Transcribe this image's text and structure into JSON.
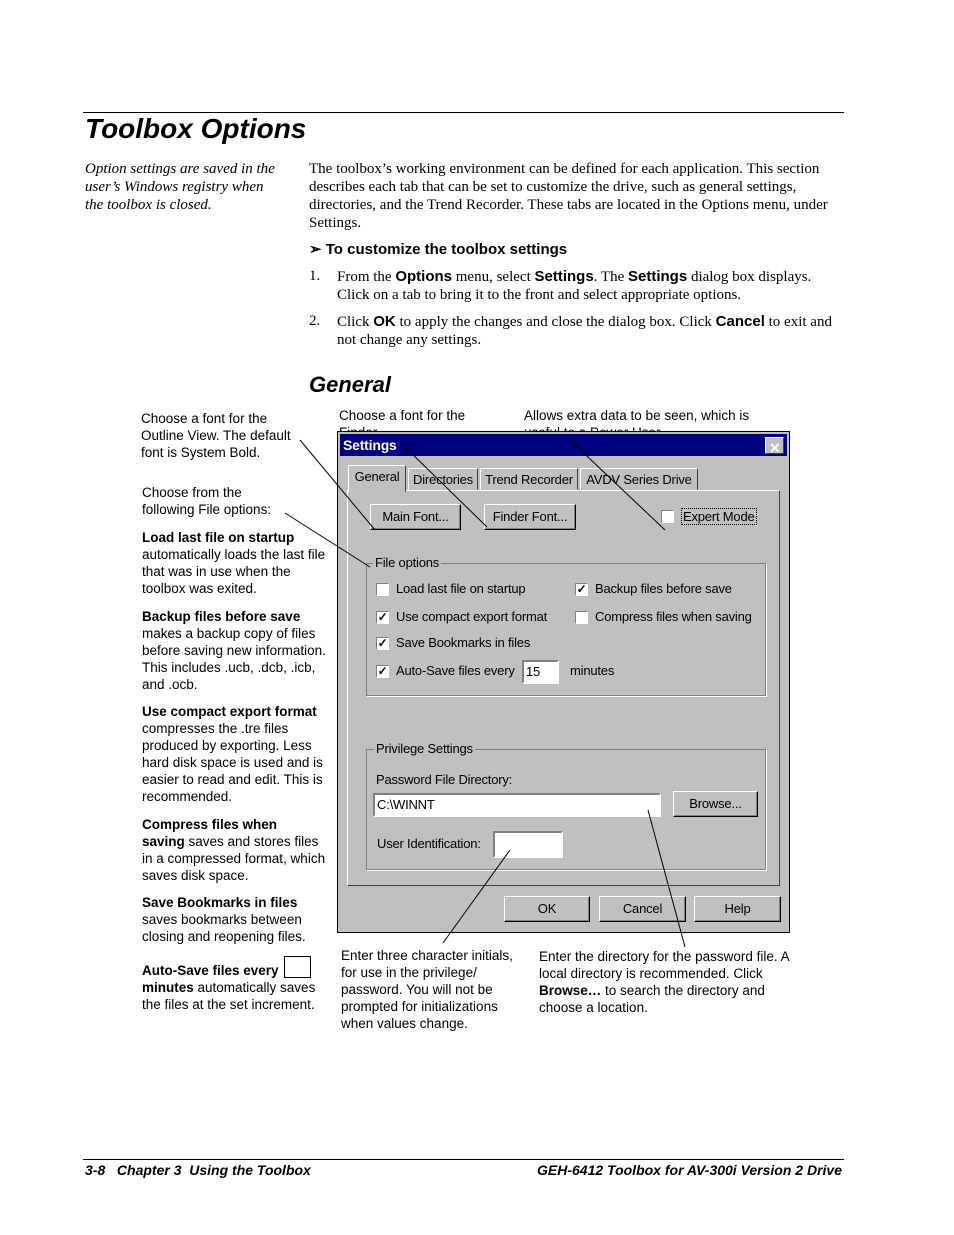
{
  "title": "Toolbox Options",
  "side_note": "Option settings are saved in the user’s Windows registry when the toolbox is closed.",
  "intro": "The toolbox’s working environment can be defined for each application. This section describes each tab that can be set to customize the drive, such as general settings, directories, and the Trend Recorder. These tabs are located in the Options menu, under Settings.",
  "procedure_heading": "➢ To customize the toolbox settings",
  "steps": [
    {
      "num": "1.",
      "a": "From the ",
      "b": "Options",
      "c": " menu, select ",
      "d": "Settings",
      "e": ". The ",
      "f": "Settings",
      "g": " dialog box displays. Click on a tab to bring it to the front and select appropriate options."
    },
    {
      "num": "2.",
      "a": "Click ",
      "b": "OK",
      "c": " to apply the changes and close the dialog box. Click ",
      "d": "Cancel",
      "e": " to exit and not change any settings."
    }
  ],
  "subheading": "General",
  "callouts": {
    "outline_font": "Choose a font for the Outline View. The default font is System Bold.",
    "finder_font": "Choose a font for the Finder.",
    "expert_mode": "Allows extra data to be seen, which is useful to a Power User.",
    "file_options_intro": "Choose from the following File options:",
    "load_last_title": "Load last file on startup",
    "load_last_text": "automatically loads the last file that was in use when the toolbox was exited.",
    "backup_title": "Backup files before save",
    "backup_text": "makes a backup copy of files before saving new information. This includes .ucb, .dcb, .icb, and .ocb.",
    "compact_title": "Use compact export format",
    "compact_text": "compresses the .tre files produced by exporting. Less hard disk space is used and is easier to read and edit. This is recommended.",
    "compress_title_1": "Compress files when",
    "compress_title_2": "saving",
    "compress_text": " saves and stores files in a compressed format, which saves disk space.",
    "bookmarks_title": "Save Bookmarks in files",
    "bookmarks_text": "saves bookmarks between closing and reopening files.",
    "autosave_title_1": "Auto-Save files every",
    "autosave_title_2": "minutes",
    "autosave_text": " automatically saves the files at the set increment.",
    "user_id": "Enter three character initials, for use in the privilege/ password. You will not be prompted for initializations when values change.",
    "password_dir_a": "Enter the directory for the password file. A local directory is recommended. Click ",
    "password_dir_b": "Browse…",
    "password_dir_c": " to search the directory and choose a location."
  },
  "dialog": {
    "title": "Settings",
    "close": "✕",
    "tabs": [
      "General",
      "Directories",
      "Trend Recorder",
      "AVDV Series Drive"
    ],
    "main_font": "Main Font...",
    "finder_font": "Finder Font...",
    "expert_mode": "Expert Mode",
    "file_options": "File options",
    "load_last": "Load last file on startup",
    "backup": "Backup files before save",
    "compact": "Use compact export format",
    "compress": "Compress files when saving",
    "bookmarks": "Save Bookmarks in files",
    "autosave": "Auto-Save files every",
    "autosave_value": "15",
    "minutes": "minutes",
    "privilege": "Privilege Settings",
    "password_dir_label": "Password File Directory:",
    "password_dir_value": "C:\\WINNT",
    "browse": "Browse...",
    "user_id_label": "User Identification:",
    "user_id_value": "",
    "ok": "OK",
    "cancel": "Cancel",
    "help": "Help",
    "checkmark": "✓"
  },
  "footer": {
    "left": "3-8   Chapter 3  Using the Toolbox",
    "right": "GEH-6412 Toolbox for AV-300i Version 2 Drive"
  }
}
